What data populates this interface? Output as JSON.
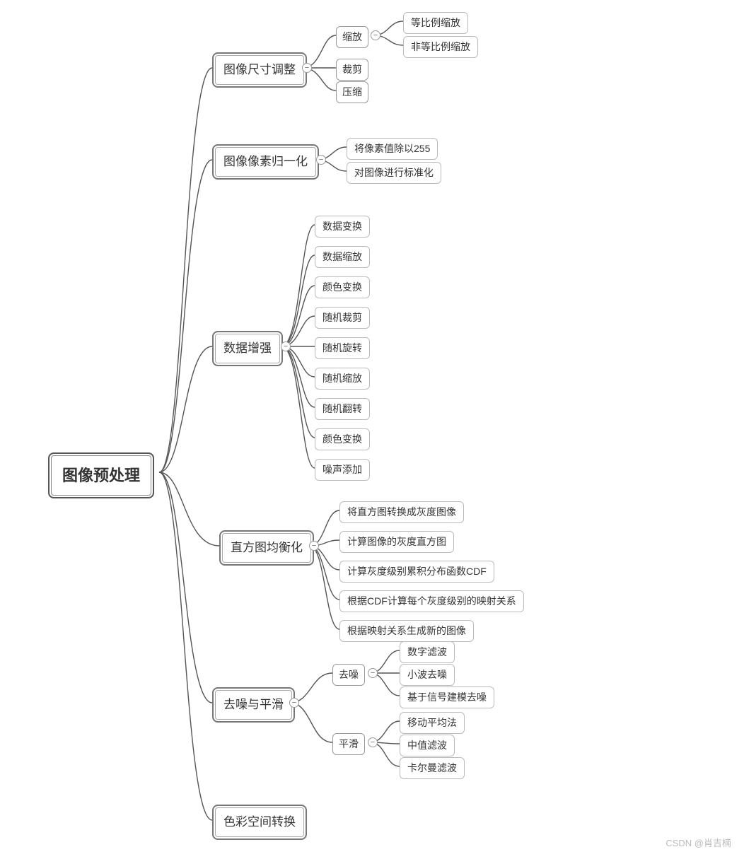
{
  "root": {
    "label": "图像预处理"
  },
  "branches": [
    {
      "label": "图像尺寸调整",
      "children": [
        {
          "label": "缩放",
          "children": [
            {
              "label": "等比例缩放"
            },
            {
              "label": "非等比例缩放"
            }
          ]
        },
        {
          "label": "裁剪"
        },
        {
          "label": "压缩"
        }
      ]
    },
    {
      "label": "图像像素归一化",
      "children": [
        {
          "label": "将像素值除以255"
        },
        {
          "label": "对图像进行标准化"
        }
      ]
    },
    {
      "label": "数据增强",
      "children": [
        {
          "label": "数据变换"
        },
        {
          "label": "数据缩放"
        },
        {
          "label": "颜色变换"
        },
        {
          "label": "随机裁剪"
        },
        {
          "label": "随机旋转"
        },
        {
          "label": "随机缩放"
        },
        {
          "label": "随机翻转"
        },
        {
          "label": "颜色变换"
        },
        {
          "label": "噪声添加"
        }
      ]
    },
    {
      "label": "直方图均衡化",
      "children": [
        {
          "label": "将直方图转换成灰度图像"
        },
        {
          "label": "计算图像的灰度直方图"
        },
        {
          "label": "计算灰度级别累积分布函数CDF"
        },
        {
          "label": "根据CDF计算每个灰度级别的映射关系"
        },
        {
          "label": "根据映射关系生成新的图像"
        }
      ]
    },
    {
      "label": "去噪与平滑",
      "children": [
        {
          "label": "去噪",
          "children": [
            {
              "label": "数字滤波"
            },
            {
              "label": "小波去噪"
            },
            {
              "label": "基于信号建模去噪"
            }
          ]
        },
        {
          "label": "平滑",
          "children": [
            {
              "label": "移动平均法"
            },
            {
              "label": "中值滤波"
            },
            {
              "label": "卡尔曼滤波"
            }
          ]
        }
      ]
    },
    {
      "label": "色彩空间转换"
    }
  ],
  "watermark": "CSDN @肖吉楠"
}
